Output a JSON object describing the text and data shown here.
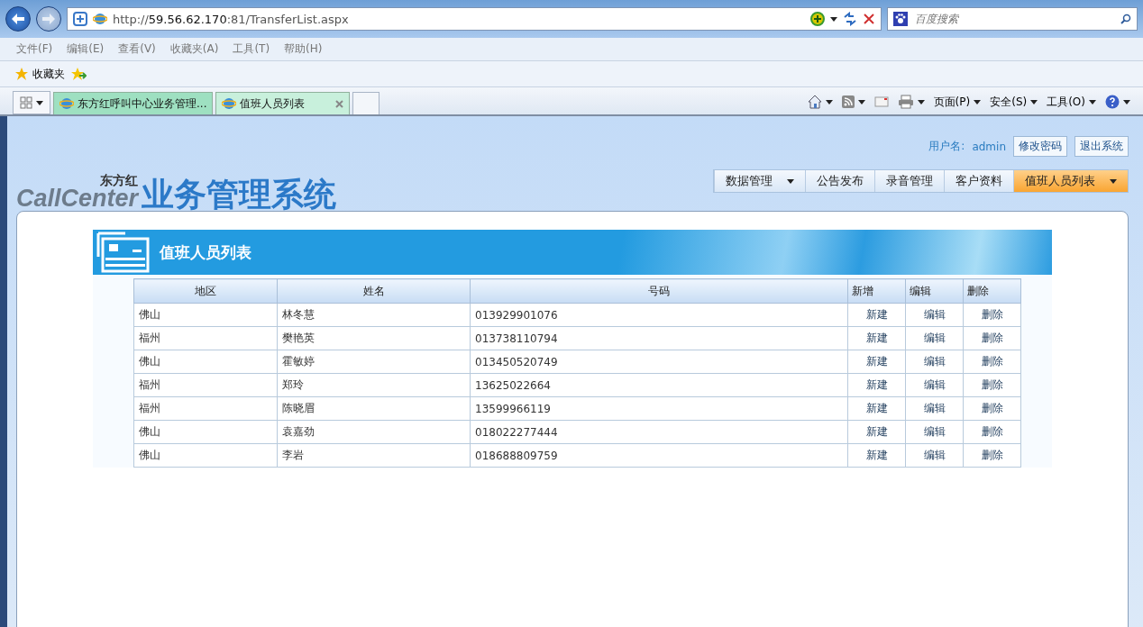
{
  "browser": {
    "address_prefix": "http://",
    "address_host": "59.56.62.170",
    "address_path": ":81/TransferList.aspx",
    "search_placeholder": "百度搜索",
    "menu": [
      "文件(F)",
      "编辑(E)",
      "查看(V)",
      "收藏夹(A)",
      "工具(T)",
      "帮助(H)"
    ],
    "favorites_label": "收藏夹",
    "tabs": [
      {
        "label": "东方红呼叫中心业务管理...",
        "selected": false
      },
      {
        "label": "值班人员列表",
        "selected": true
      }
    ],
    "commands": [
      "页面(P)",
      "安全(S)",
      "工具(O)"
    ]
  },
  "header": {
    "logo_small": "东方红",
    "logo_brand": "CallCenter",
    "logo_title": "业务管理系统",
    "user_label": "用户名:",
    "user_name": "admin",
    "buttons": [
      "修改密码",
      "退出系统"
    ],
    "nav": [
      {
        "label": "数据管理",
        "selected": false,
        "dropdown": true
      },
      {
        "label": "公告发布",
        "selected": false,
        "dropdown": false
      },
      {
        "label": "录音管理",
        "selected": false,
        "dropdown": false
      },
      {
        "label": "客户资料",
        "selected": false,
        "dropdown": false
      },
      {
        "label": "值班人员列表",
        "selected": true,
        "dropdown": true
      }
    ]
  },
  "panel": {
    "title": "值班人员列表",
    "columns": [
      "地区",
      "姓名",
      "号码",
      "新增",
      "编辑",
      "删除"
    ],
    "rows": [
      [
        "佛山",
        "林冬慧",
        "013929901076",
        "新建",
        "编辑",
        "删除"
      ],
      [
        "福州",
        "樊艳英",
        "013738110794",
        "新建",
        "编辑",
        "删除"
      ],
      [
        "佛山",
        "霍敏婷",
        "013450520749",
        "新建",
        "编辑",
        "删除"
      ],
      [
        "福州",
        "郑玲",
        "13625022664",
        "新建",
        "编辑",
        "删除"
      ],
      [
        "福州",
        "陈晓眉",
        "13599966119",
        "新建",
        "编辑",
        "删除"
      ],
      [
        "佛山",
        "袁嘉劲",
        "018022277444",
        "新建",
        "编辑",
        "删除"
      ],
      [
        "佛山",
        "李岩",
        "018688809759",
        "新建",
        "编辑",
        "删除"
      ]
    ]
  }
}
